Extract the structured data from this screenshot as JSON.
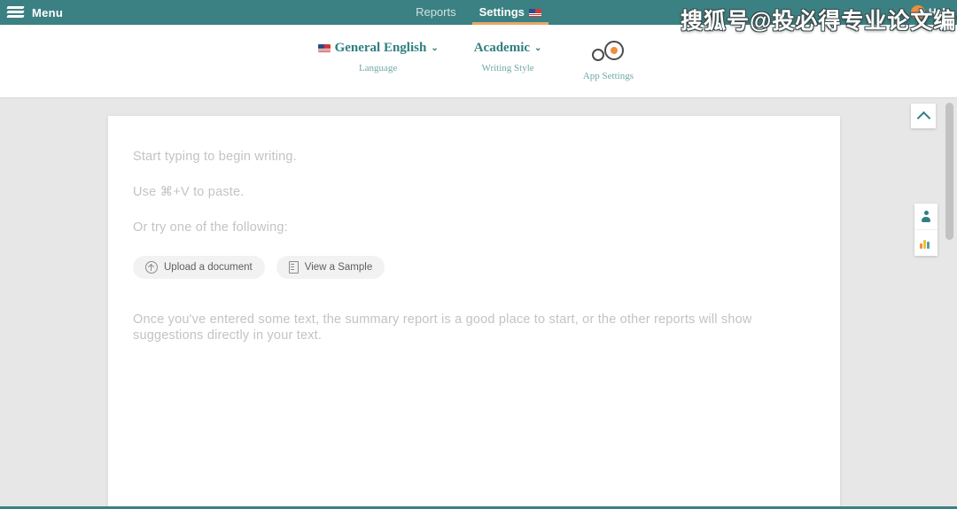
{
  "topbar": {
    "brand_label": "Menu",
    "logo_icon": "stacked-bars-logo",
    "nav": [
      {
        "label": "Reports",
        "active": false
      },
      {
        "label": "Settings",
        "active": true,
        "flag": "us-flag"
      }
    ],
    "help_label": "Help",
    "avatar_icon": "user-avatar-circle",
    "accent_color": "#e6a86a",
    "bar_color": "#3b8183"
  },
  "watermark": {
    "text": "搜狐号@投必得专业论文编译"
  },
  "settings_strip": {
    "items": [
      {
        "value": "General English",
        "caption": "Language",
        "icon": "us-flag",
        "chevron": "⌄"
      },
      {
        "value": "Academic",
        "caption": "Writing Style",
        "chevron": "⌄"
      },
      {
        "caption": "App Settings",
        "icon": "gears-icon"
      }
    ]
  },
  "editor": {
    "placeholder_lines": [
      "Start typing to begin writing.",
      "Use ⌘+V to paste.",
      "Or try one of the following:"
    ],
    "buttons": [
      {
        "label": "Upload a document",
        "icon": "upload-circle-icon"
      },
      {
        "label": "View a Sample",
        "icon": "document-icon"
      }
    ],
    "hint": "Once you've entered some text, the summary report is a good place to start, or the other reports will show suggestions directly in your text."
  },
  "right_rail": {
    "collapse_icon": "chevron-up-icon",
    "buttons": [
      {
        "icon": "person-icon",
        "name": "author-panel"
      },
      {
        "icon": "bar-chart-icon",
        "name": "statistics-panel"
      }
    ]
  }
}
